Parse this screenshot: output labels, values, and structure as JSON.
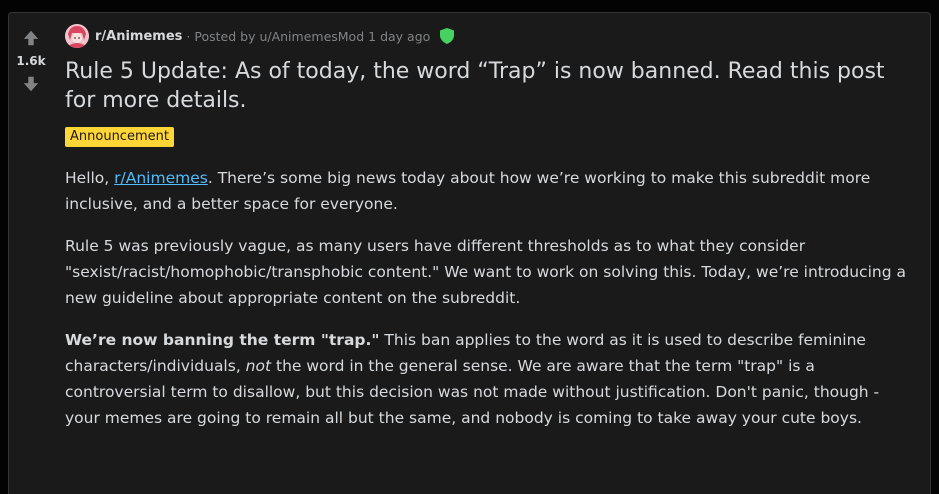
{
  "vote": {
    "score": "1.6k"
  },
  "meta": {
    "subreddit": "r/Animemes",
    "separator": "·",
    "posted_by": "Posted by u/AnimemesMod",
    "time": "1 day ago"
  },
  "post": {
    "title": "Rule 5 Update: As of today, the word “Trap” is now banned. Read this post for more details.",
    "flair": "Announcement",
    "flair_color": "#ffd635",
    "p1_prefix": "Hello, ",
    "p1_link": "r/Animemes",
    "p1_suffix": ". There’s some big news today about how we’re working to make this subreddit more inclusive, and a better space for everyone.",
    "p2": "Rule 5 was previously vague, as many users have different thresholds as to what they consider \"sexist/racist/homophobic/transphobic content.\" We want to work on solving this. Today, we’re introducing a new guideline about appropriate content on the subreddit.",
    "p3_bold": "We’re now banning the term \"trap.\"",
    "p3_a": " This ban applies to the word as it is used to describe feminine characters/individuals, ",
    "p3_italic": "not",
    "p3_b": " the word in the general sense. We are aware that the term \"trap\" is a controversial term to disallow, but this decision was not made without justification. Don't panic, though - your memes are going to remain all but the same, and nobody is coming to take away your cute boys."
  },
  "icons": {
    "upvote": "upvote-arrow-icon",
    "downvote": "downvote-arrow-icon",
    "avatar": "subreddit-avatar",
    "shield": "moderator-shield-icon"
  },
  "colors": {
    "background": "#030303",
    "card": "#1a1a1b",
    "text": "#d7dadc",
    "muted": "#818384",
    "link": "#4fbcff",
    "mod_green": "#46d160"
  }
}
